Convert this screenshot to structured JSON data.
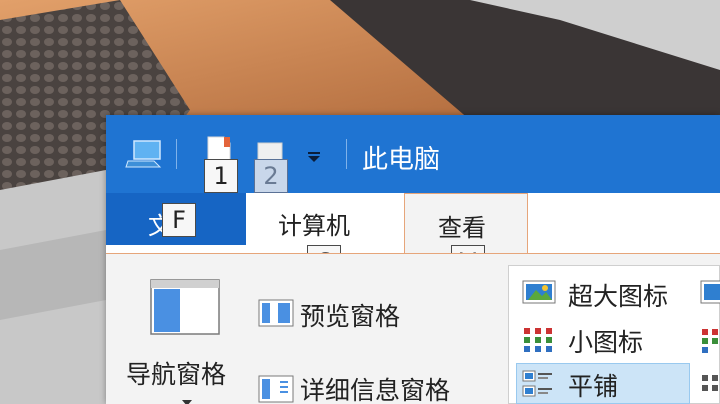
{
  "window": {
    "title": "此电脑"
  },
  "quick_access": {
    "icons": [
      "computer-icon",
      "properties-icon",
      "new-folder-icon",
      "customize-dropdown-icon"
    ],
    "keytips": [
      "1",
      "2"
    ]
  },
  "tabs": [
    {
      "label": "文件",
      "keytip": "F"
    },
    {
      "label": "计算机",
      "keytip": "C"
    },
    {
      "label": "查看",
      "keytip": "V",
      "active": true
    }
  ],
  "ribbon": {
    "panes": {
      "navigation_pane_label": "导航窗格",
      "preview_pane_label": "预览窗格",
      "details_pane_label": "详细信息窗格"
    },
    "layout": {
      "extra_large_icons": "超大图标",
      "small_icons": "小图标",
      "tiles": "平铺",
      "selected": "平铺"
    }
  },
  "colors": {
    "titlebar": "#1f74d2",
    "file_tab": "#1665c4",
    "ribbon": "#f3f3f3",
    "active_tab_border": "#e6a57a",
    "selection": "#cce4f7"
  }
}
